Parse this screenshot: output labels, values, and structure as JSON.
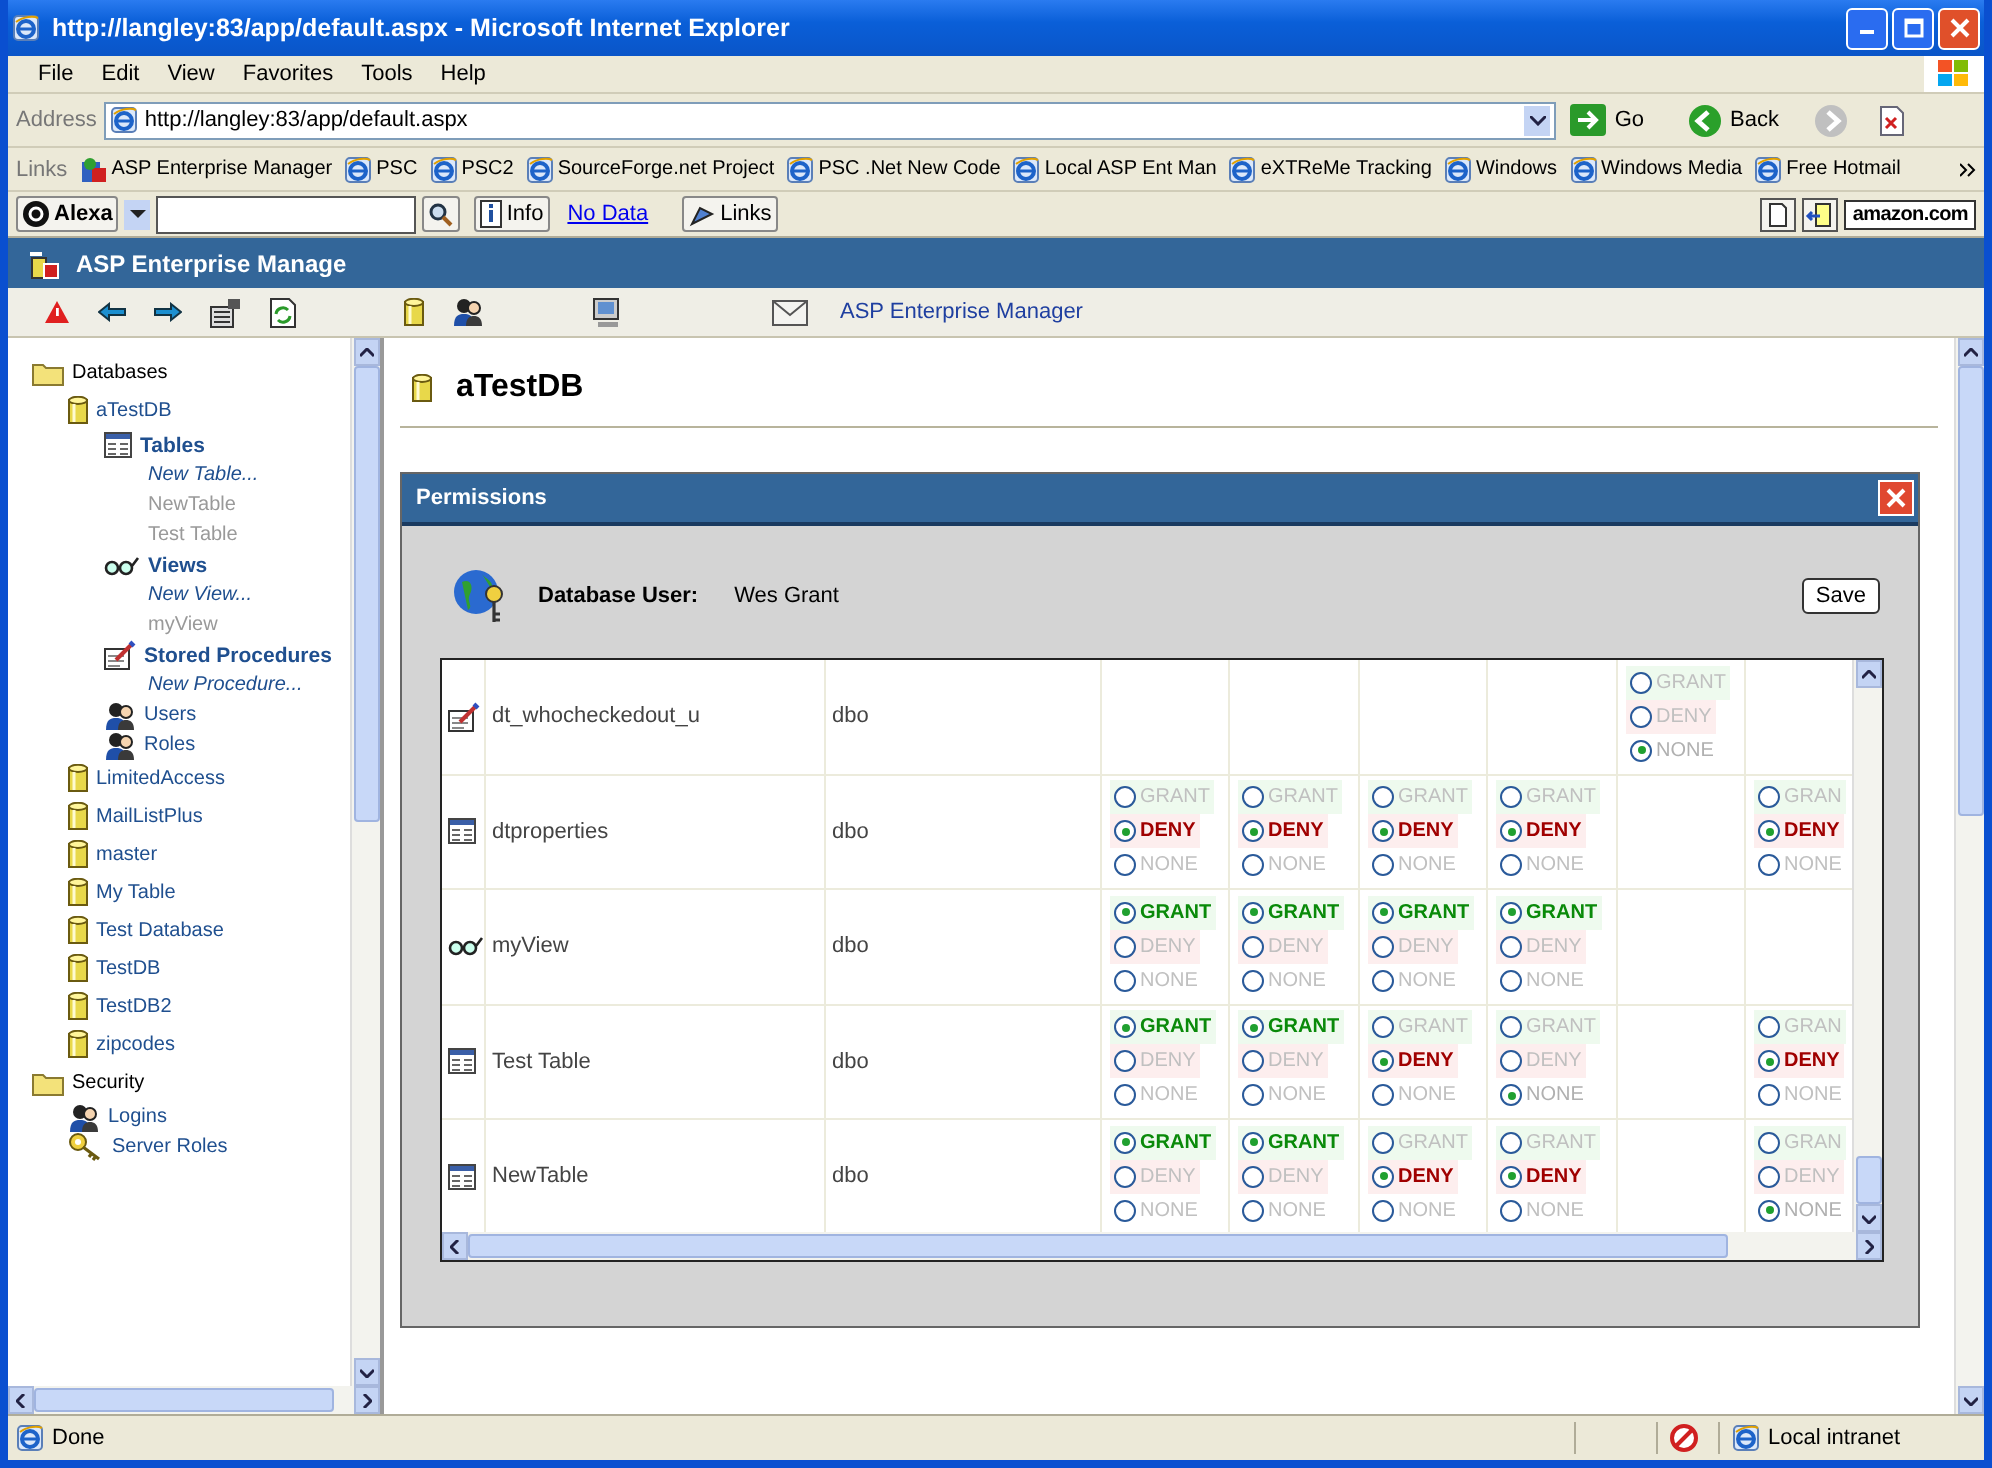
{
  "window": {
    "title": "http://langley:83/app/default.aspx - Microsoft Internet Explorer"
  },
  "menu": [
    "File",
    "Edit",
    "View",
    "Favorites",
    "Tools",
    "Help"
  ],
  "address": {
    "label": "Address",
    "value": "http://langley:83/app/default.aspx",
    "go": "Go",
    "back": "Back"
  },
  "links": {
    "label": "Links",
    "items": [
      {
        "label": "ASP Enterprise Manager",
        "kind": "app"
      },
      {
        "label": "PSC",
        "kind": "page"
      },
      {
        "label": "PSC2",
        "kind": "page"
      },
      {
        "label": "SourceForge.net Project",
        "kind": "page"
      },
      {
        "label": "PSC .Net New Code",
        "kind": "page"
      },
      {
        "label": "Local ASP Ent Man",
        "kind": "page"
      },
      {
        "label": "eXTReMe Tracking",
        "kind": "page"
      },
      {
        "label": "Windows",
        "kind": "page"
      },
      {
        "label": "Windows Media",
        "kind": "page"
      },
      {
        "label": "Free Hotmail",
        "kind": "page"
      }
    ]
  },
  "alexa": {
    "brand": "Alexa",
    "info": "Info",
    "no_data": "No Data",
    "links": "Links",
    "amazon": "amazon.com"
  },
  "app": {
    "title": "ASP Enterprise Manage",
    "toolbar_link": "ASP Enterprise Manager"
  },
  "sidebar": {
    "items": [
      {
        "label": "Databases",
        "kind": "folder",
        "children": [
          {
            "label": "aTestDB",
            "kind": "database",
            "children": [
              {
                "label": "Tables",
                "kind": "tables",
                "children": [
                  {
                    "label": "New Table...",
                    "kind": "new"
                  },
                  {
                    "label": "NewTable",
                    "kind": "object"
                  },
                  {
                    "label": "Test Table",
                    "kind": "object"
                  }
                ]
              },
              {
                "label": "Views",
                "kind": "views",
                "children": [
                  {
                    "label": "New View...",
                    "kind": "new"
                  },
                  {
                    "label": "myView",
                    "kind": "object"
                  }
                ]
              },
              {
                "label": "Stored Procedures",
                "kind": "procedures",
                "children": [
                  {
                    "label": "New Procedure...",
                    "kind": "new"
                  }
                ]
              },
              {
                "label": "Users",
                "kind": "users"
              },
              {
                "label": "Roles",
                "kind": "roles"
              }
            ]
          },
          {
            "label": "LimitedAccess",
            "kind": "database"
          },
          {
            "label": "MailListPlus",
            "kind": "database"
          },
          {
            "label": "master",
            "kind": "database"
          },
          {
            "label": "My Table",
            "kind": "database"
          },
          {
            "label": "Test Database",
            "kind": "database"
          },
          {
            "label": "TestDB",
            "kind": "database"
          },
          {
            "label": "TestDB2",
            "kind": "database"
          },
          {
            "label": "zipcodes",
            "kind": "database"
          }
        ]
      },
      {
        "label": "Security",
        "kind": "folder",
        "children": [
          {
            "label": "Logins",
            "kind": "logins"
          },
          {
            "label": "Server Roles",
            "kind": "server_roles"
          }
        ]
      }
    ]
  },
  "content": {
    "heading": "aTestDB"
  },
  "dialog": {
    "title": "Permissions",
    "user_label": "Database User:",
    "user": "Wes Grant",
    "save": "Save",
    "rows": [
      {
        "kind": "procedure",
        "name": "dt_whocheckedout_u",
        "owner": "dbo",
        "cells": [
          {
            "kind": "empty"
          },
          {
            "kind": "empty"
          },
          {
            "kind": "empty"
          },
          {
            "kind": "empty"
          },
          {
            "kind": "radio",
            "options": [
              {
                "label": "GRANT",
                "kind": "grant",
                "selected": false
              },
              {
                "label": "DENY",
                "kind": "deny",
                "selected": false
              },
              {
                "label": "NONE",
                "kind": "none",
                "selected": true
              }
            ]
          },
          {
            "kind": "empty"
          }
        ]
      },
      {
        "kind": "table",
        "name": "dtproperties",
        "owner": "dbo",
        "cells": [
          {
            "kind": "radio",
            "options": [
              {
                "label": "GRANT",
                "kind": "grant",
                "selected": false
              },
              {
                "label": "DENY",
                "kind": "deny",
                "selected": true
              },
              {
                "label": "NONE",
                "kind": "none",
                "selected": false
              }
            ]
          },
          {
            "kind": "radio",
            "options": [
              {
                "label": "GRANT",
                "kind": "grant",
                "selected": false
              },
              {
                "label": "DENY",
                "kind": "deny",
                "selected": true
              },
              {
                "label": "NONE",
                "kind": "none",
                "selected": false
              }
            ]
          },
          {
            "kind": "radio",
            "options": [
              {
                "label": "GRANT",
                "kind": "grant",
                "selected": false
              },
              {
                "label": "DENY",
                "kind": "deny",
                "selected": true
              },
              {
                "label": "NONE",
                "kind": "none",
                "selected": false
              }
            ]
          },
          {
            "kind": "radio",
            "options": [
              {
                "label": "GRANT",
                "kind": "grant",
                "selected": false
              },
              {
                "label": "DENY",
                "kind": "deny",
                "selected": true
              },
              {
                "label": "NONE",
                "kind": "none",
                "selected": false
              }
            ]
          },
          {
            "kind": "empty"
          },
          {
            "kind": "radio",
            "options": [
              {
                "label": "GRAN",
                "kind": "grant",
                "selected": false
              },
              {
                "label": "DENY",
                "kind": "deny",
                "selected": true
              },
              {
                "label": "NONE",
                "kind": "none",
                "selected": false
              }
            ]
          }
        ]
      },
      {
        "kind": "view",
        "name": "myView",
        "owner": "dbo",
        "cells": [
          {
            "kind": "radio",
            "options": [
              {
                "label": "GRANT",
                "kind": "grant",
                "selected": true
              },
              {
                "label": "DENY",
                "kind": "deny",
                "selected": false
              },
              {
                "label": "NONE",
                "kind": "none",
                "selected": false
              }
            ]
          },
          {
            "kind": "radio",
            "options": [
              {
                "label": "GRANT",
                "kind": "grant",
                "selected": true
              },
              {
                "label": "DENY",
                "kind": "deny",
                "selected": false
              },
              {
                "label": "NONE",
                "kind": "none",
                "selected": false
              }
            ]
          },
          {
            "kind": "radio",
            "options": [
              {
                "label": "GRANT",
                "kind": "grant",
                "selected": true
              },
              {
                "label": "DENY",
                "kind": "deny",
                "selected": false
              },
              {
                "label": "NONE",
                "kind": "none",
                "selected": false
              }
            ]
          },
          {
            "kind": "radio",
            "options": [
              {
                "label": "GRANT",
                "kind": "grant",
                "selected": true
              },
              {
                "label": "DENY",
                "kind": "deny",
                "selected": false
              },
              {
                "label": "NONE",
                "kind": "none",
                "selected": false
              }
            ]
          },
          {
            "kind": "empty"
          },
          {
            "kind": "empty"
          }
        ]
      },
      {
        "kind": "table",
        "name": "Test Table",
        "owner": "dbo",
        "cells": [
          {
            "kind": "radio",
            "options": [
              {
                "label": "GRANT",
                "kind": "grant",
                "selected": true
              },
              {
                "label": "DENY",
                "kind": "deny",
                "selected": false
              },
              {
                "label": "NONE",
                "kind": "none",
                "selected": false
              }
            ]
          },
          {
            "kind": "radio",
            "options": [
              {
                "label": "GRANT",
                "kind": "grant",
                "selected": true
              },
              {
                "label": "DENY",
                "kind": "deny",
                "selected": false
              },
              {
                "label": "NONE",
                "kind": "none",
                "selected": false
              }
            ]
          },
          {
            "kind": "radio",
            "options": [
              {
                "label": "GRANT",
                "kind": "grant",
                "selected": false
              },
              {
                "label": "DENY",
                "kind": "deny",
                "selected": true
              },
              {
                "label": "NONE",
                "kind": "none",
                "selected": false
              }
            ]
          },
          {
            "kind": "radio",
            "options": [
              {
                "label": "GRANT",
                "kind": "grant",
                "selected": false
              },
              {
                "label": "DENY",
                "kind": "deny",
                "selected": false
              },
              {
                "label": "NONE",
                "kind": "none",
                "selected": true
              }
            ]
          },
          {
            "kind": "empty"
          },
          {
            "kind": "radio",
            "options": [
              {
                "label": "GRAN",
                "kind": "grant",
                "selected": false
              },
              {
                "label": "DENY",
                "kind": "deny",
                "selected": true
              },
              {
                "label": "NONE",
                "kind": "none",
                "selected": false
              }
            ]
          }
        ]
      },
      {
        "kind": "table",
        "name": "NewTable",
        "owner": "dbo",
        "cells": [
          {
            "kind": "radio",
            "options": [
              {
                "label": "GRANT",
                "kind": "grant",
                "selected": true
              },
              {
                "label": "DENY",
                "kind": "deny",
                "selected": false
              },
              {
                "label": "NONE",
                "kind": "none",
                "selected": false
              }
            ]
          },
          {
            "kind": "radio",
            "options": [
              {
                "label": "GRANT",
                "kind": "grant",
                "selected": true
              },
              {
                "label": "DENY",
                "kind": "deny",
                "selected": false
              },
              {
                "label": "NONE",
                "kind": "none",
                "selected": false
              }
            ]
          },
          {
            "kind": "radio",
            "options": [
              {
                "label": "GRANT",
                "kind": "grant",
                "selected": false
              },
              {
                "label": "DENY",
                "kind": "deny",
                "selected": true
              },
              {
                "label": "NONE",
                "kind": "none",
                "selected": false
              }
            ]
          },
          {
            "kind": "radio",
            "options": [
              {
                "label": "GRANT",
                "kind": "grant",
                "selected": false
              },
              {
                "label": "DENY",
                "kind": "deny",
                "selected": true
              },
              {
                "label": "NONE",
                "kind": "none",
                "selected": false
              }
            ]
          },
          {
            "kind": "empty"
          },
          {
            "kind": "radio",
            "options": [
              {
                "label": "GRAN",
                "kind": "grant",
                "selected": false
              },
              {
                "label": "DENY",
                "kind": "deny",
                "selected": false
              },
              {
                "label": "NONE",
                "kind": "none",
                "selected": true
              }
            ]
          }
        ]
      }
    ]
  },
  "status_bar": {
    "text": "Done",
    "zone": "Local intranet"
  }
}
